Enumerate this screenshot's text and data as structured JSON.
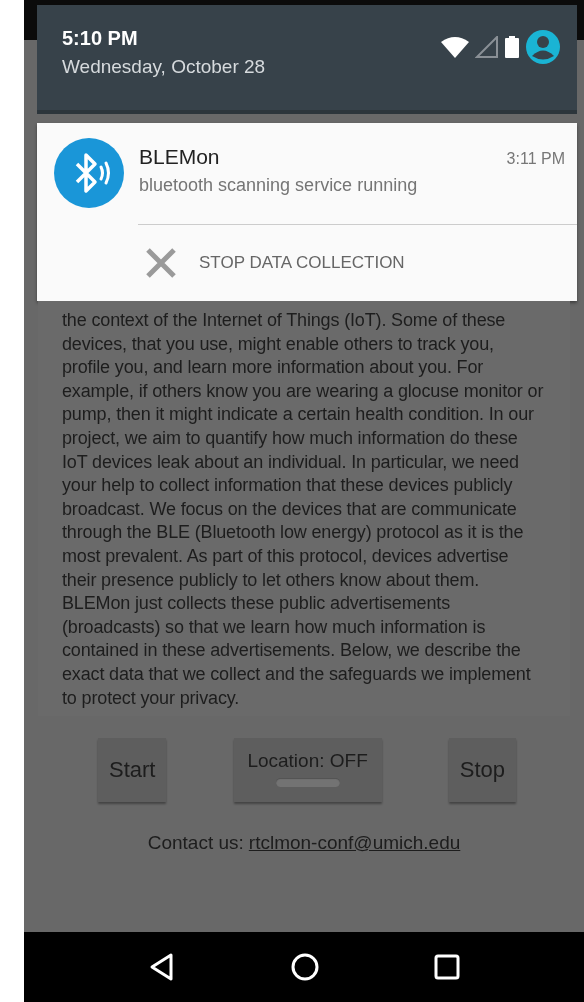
{
  "shade": {
    "time": "5:10 PM",
    "date": "Wednesday, October 28"
  },
  "notification": {
    "app": "BLEMon",
    "time": "3:11 PM",
    "text": "bluetooth scanning service running",
    "action": "STOP DATA COLLECTION"
  },
  "body_text": "the context of the Internet of Things (IoT). Some of these devices, that you use, might enable others to track you, profile you, and learn more information about you. For example, if others know you are wearing a glocuse monitor or pump, then it might indicate a certain health condition. In our project, we aim to quantify how much information do these IoT devices leak about an individual. In particular, we need your help to collect information that these devices publicly broadcast. We focus on the devices that are communicate through the BLE (Bluetooth low energy) protocol as it is the most prevalent. As part of this protocol, devices advertise their presence publicly to let others know about them. BLEMon just collects these public advertisements (broadcasts) so that we learn how much information is contained in these advertisements. Below, we describe the exact data that we collect and the safeguards we implement to protect your privacy.",
  "buttons": [
    {
      "kind": "button",
      "label": "Start"
    },
    {
      "kind": "toggle",
      "label": "Location: OFF",
      "on": false
    },
    {
      "kind": "button",
      "label": "Stop"
    }
  ],
  "contact": {
    "label": "Contact us:",
    "link": "rtclmon-conf@umich.edu"
  }
}
